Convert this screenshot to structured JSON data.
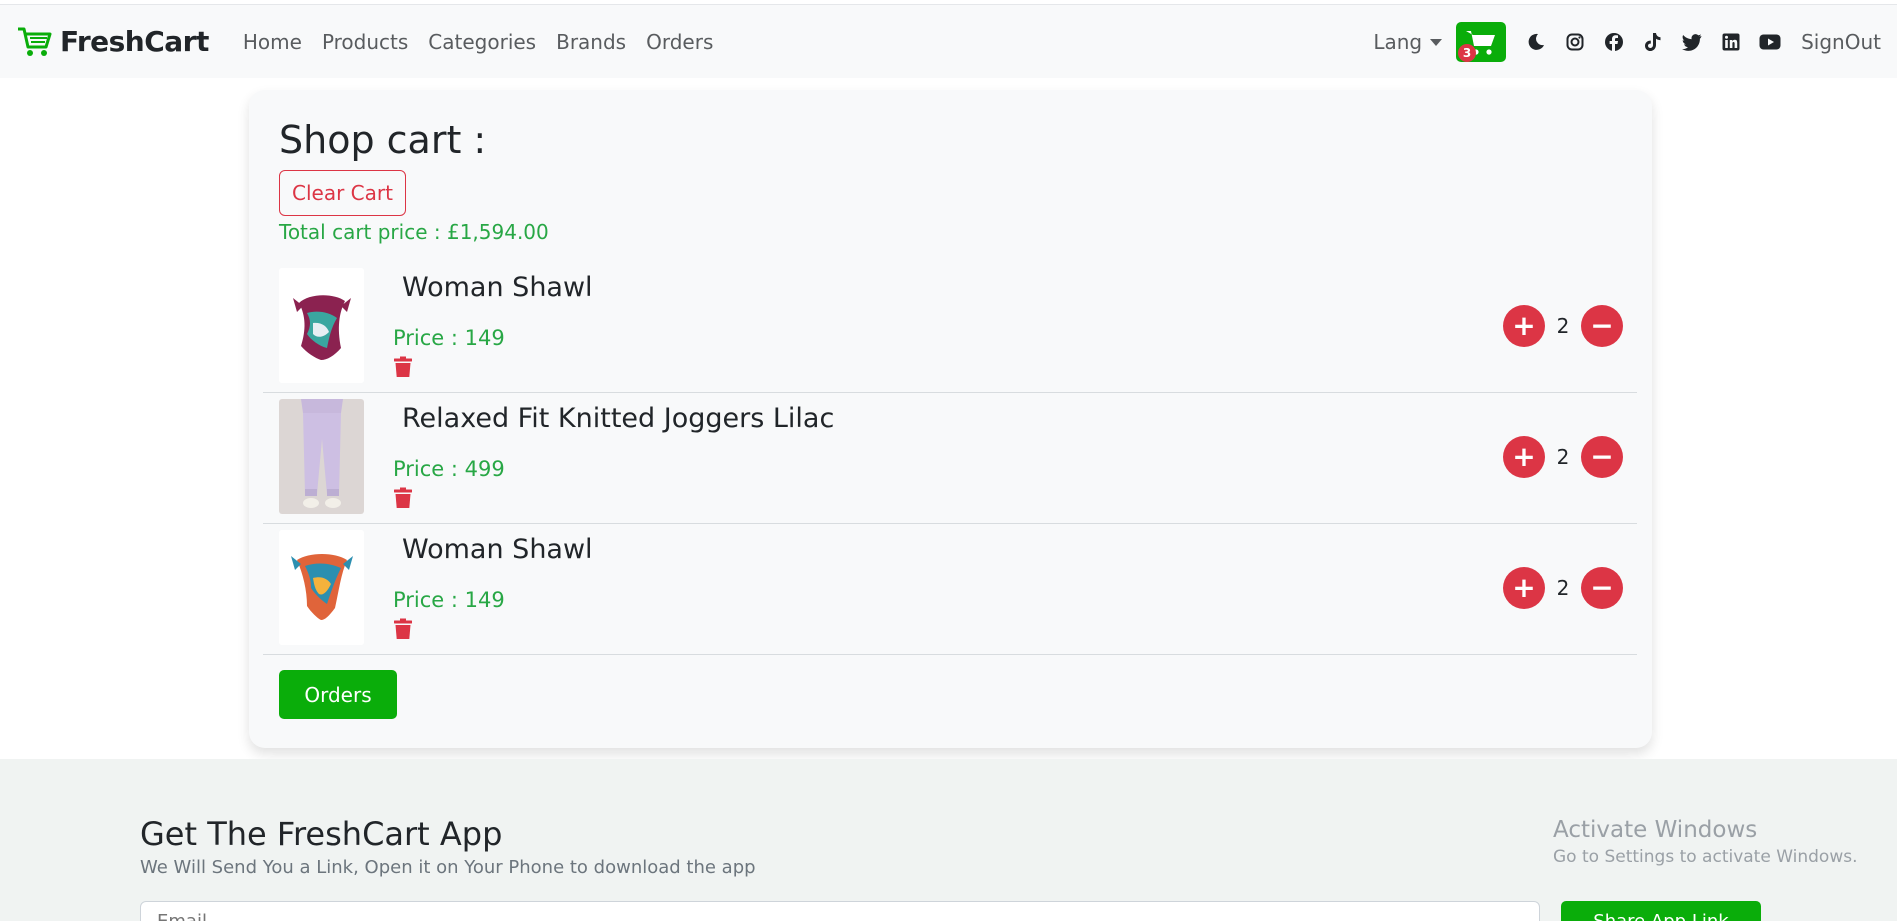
{
  "nav": {
    "brand": "FreshCart",
    "links": [
      "Home",
      "Products",
      "Categories",
      "Brands",
      "Orders"
    ],
    "lang": "Lang",
    "cart_count": "3",
    "signout": "SignOut"
  },
  "cart": {
    "title": "Shop cart :",
    "clear_label": "Clear Cart",
    "total_text": "Total cart price : £1,594.00",
    "items": [
      {
        "name": "Woman Shawl",
        "price": "Price : 149",
        "qty": "2"
      },
      {
        "name": "Relaxed Fit Knitted Joggers Lilac",
        "price": "Price : 499",
        "qty": "2"
      },
      {
        "name": "Woman Shawl",
        "price": "Price : 149",
        "qty": "2"
      }
    ],
    "orders_label": "Orders"
  },
  "footer": {
    "title": "Get The FreshCart App",
    "subtitle": "We Will Send You a Link, Open it on Your Phone to download the app",
    "email_placeholder": "Email ..",
    "share_label": "Share App Link"
  },
  "overlay": {
    "activate_title": "Activate Windows",
    "activate_sub": "Go to Settings to activate Windows."
  },
  "colors": {
    "accent": "#0aad0a",
    "danger": "#dc3545",
    "price": "#28a745"
  }
}
